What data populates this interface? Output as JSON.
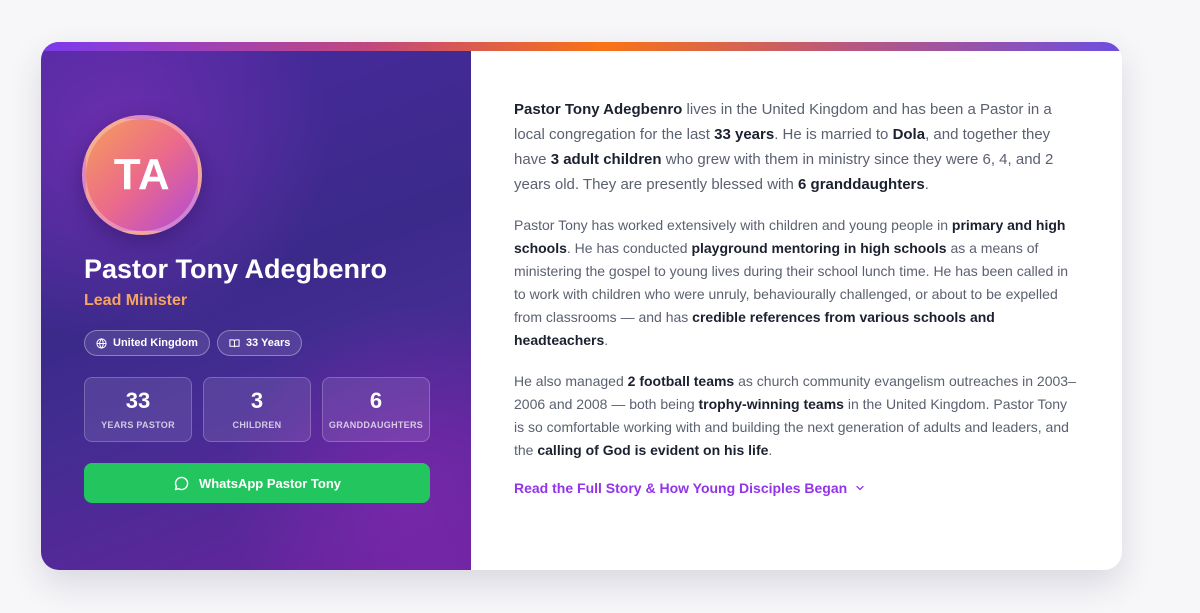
{
  "profile": {
    "initials": "TA",
    "name": "Pastor Tony Adegbenro",
    "role": "Lead Minister",
    "chips": [
      {
        "icon": "globe-icon",
        "label": "United Kingdom"
      },
      {
        "icon": "book-icon",
        "label": "33 Years"
      }
    ],
    "stats": [
      {
        "value": "33",
        "label": "YEARS PASTOR"
      },
      {
        "value": "3",
        "label": "CHILDREN"
      },
      {
        "value": "6",
        "label": "GRANDDAUGHTERS"
      }
    ],
    "whatsapp_label": "WhatsApp Pastor Tony",
    "whatsapp_icon": "whatsapp-icon"
  },
  "bio": {
    "p1": [
      {
        "t": "Pastor Tony Adegbenro",
        "b": true
      },
      {
        "t": " lives in the United Kingdom and has been a Pastor in a local congregation for the last "
      },
      {
        "t": "33 years",
        "b": true
      },
      {
        "t": ". He is married to "
      },
      {
        "t": "Dola",
        "b": true
      },
      {
        "t": ", and together they have "
      },
      {
        "t": "3 adult children",
        "b": true
      },
      {
        "t": " who grew with them in ministry since they were 6, 4, and 2 years old. They are presently blessed with "
      },
      {
        "t": "6 granddaughters",
        "b": true
      },
      {
        "t": "."
      }
    ],
    "p2": [
      {
        "t": "Pastor Tony has worked extensively with children and young people in "
      },
      {
        "t": "primary and high schools",
        "b": true
      },
      {
        "t": ". He has conducted "
      },
      {
        "t": "playground mentoring in high schools",
        "b": true
      },
      {
        "t": " as a means of ministering the gospel to young lives during their school lunch time. He has been called in to work with children who were unruly, behaviourally challenged, or about to be expelled from classrooms — and has "
      },
      {
        "t": "credible references from various schools and headteachers",
        "b": true
      },
      {
        "t": "."
      }
    ],
    "p3": [
      {
        "t": "He also managed "
      },
      {
        "t": "2 football teams",
        "b": true
      },
      {
        "t": " as church community evangelism outreaches in 2003–2006 and 2008 — both being "
      },
      {
        "t": "trophy-winning teams",
        "b": true
      },
      {
        "t": " in the United Kingdom. Pastor Tony is so comfortable working with and building the next generation of adults and leaders, and the "
      },
      {
        "t": "calling of God is evident on his life",
        "b": true
      },
      {
        "t": "."
      }
    ],
    "read_more_label": "Read the Full Story & How Young Disciples Began",
    "read_more_icon": "chevron-down-icon"
  },
  "colors": {
    "accent_orange": "#f6a560",
    "whatsapp_green": "#22c55e",
    "link_purple": "#9333ea",
    "panel_purple": "#3b2a8a"
  }
}
